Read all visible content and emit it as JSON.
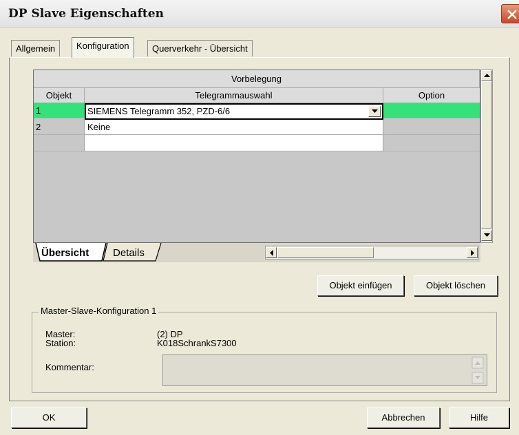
{
  "window": {
    "title": "DP Slave Eigenschaften"
  },
  "tabs": [
    {
      "label": "Allgemein",
      "active": false
    },
    {
      "label": "Konfiguration",
      "active": true
    },
    {
      "label": "Querverkehr - Übersicht",
      "active": false
    }
  ],
  "grid": {
    "group_header": "Vorbelegung",
    "columns": [
      "Objekt",
      "Telegrammauswahl",
      "Option"
    ],
    "rows": [
      {
        "objekt": "1",
        "telegramm": "SIEMENS Telegramm 352, PZD-6/6",
        "option": "",
        "selected": true
      },
      {
        "objekt": "2",
        "telegramm": "Keine",
        "option": ""
      }
    ],
    "selected_row_color": "#33e27a",
    "sheet_tabs": [
      "Übersicht",
      "Details"
    ]
  },
  "buttons": {
    "insert": "Objekt einfügen",
    "delete": "Objekt löschen",
    "ok": "OK",
    "cancel": "Abbrechen",
    "help": "Hilfe"
  },
  "master_slave": {
    "legend": "Master-Slave-Konfiguration 1",
    "master_label": "Master:",
    "master_value": "(2) DP",
    "station_label": "Station:",
    "station_value": "K018SchrankS7300",
    "comment_label": "Kommentar:",
    "comment_value": ""
  }
}
